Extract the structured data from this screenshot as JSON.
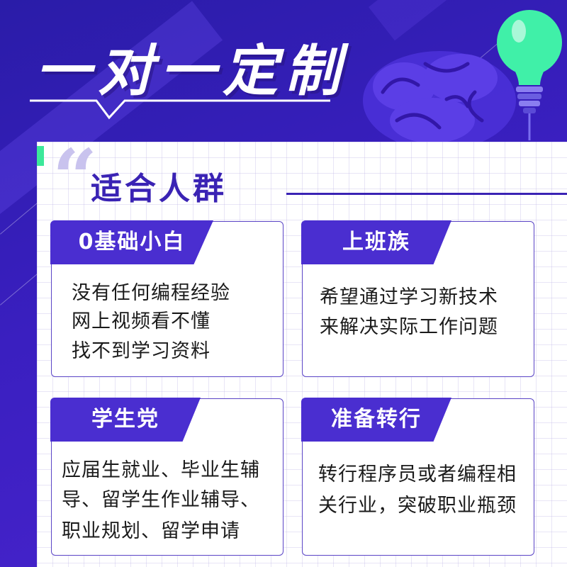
{
  "poster": {
    "title": "一对一定制",
    "section_title": "适合人群",
    "quote_mark": "“"
  },
  "cards": [
    {
      "label": "0基础小白",
      "lines": [
        "没有任何编程经验",
        "网上视频看不懂",
        "找不到学习资料"
      ]
    },
    {
      "label": "上班族",
      "lines": [
        "希望通过学习新技术",
        "来解决实际工作问题"
      ]
    },
    {
      "label": "学生党",
      "lines": [
        "应届生就业、毕业生辅",
        "导、留学生作业辅导、",
        "职业规划、留学申请"
      ]
    },
    {
      "label": "准备转行",
      "lines": [
        "转行程序员或者编程相",
        "关行业，突破职业瓶颈"
      ]
    }
  ],
  "colors": {
    "background": "#2c1ba6",
    "primary": "#4a2ed0",
    "title_text": "#3a23b4",
    "accent_green": "#3ce89a",
    "bulb": "#40f0a8"
  },
  "icons": [
    "speech-bubble-icon",
    "brain-icon",
    "light-bulb-icon",
    "quote-mark-icon"
  ]
}
